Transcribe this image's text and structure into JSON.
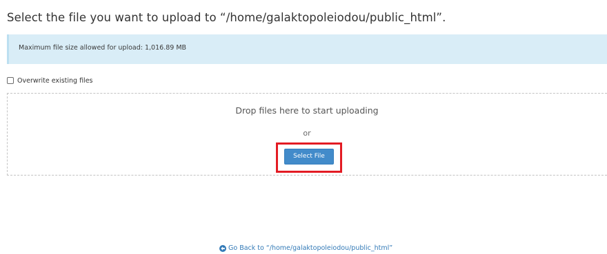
{
  "page": {
    "title": "Select the file you want to upload to “/home/galaktopoleiodou/public_html”."
  },
  "info_alert": {
    "text": "Maximum file size allowed for upload: 1,016.89 MB",
    "background_color": "#d9edf7"
  },
  "options": {
    "overwrite_label": "Overwrite existing files",
    "overwrite_checked": false
  },
  "dropzone": {
    "drop_text": "Drop files here to start uploading",
    "or_text": "or",
    "select_file_label": "Select File",
    "button_color": "#428bca",
    "highlight_color": "#e31b23"
  },
  "footer": {
    "go_back_icon": "arrow-circle-left-icon",
    "go_back_label": "Go Back to “/home/galaktopoleiodou/public_html”",
    "link_color": "#337ab7"
  }
}
